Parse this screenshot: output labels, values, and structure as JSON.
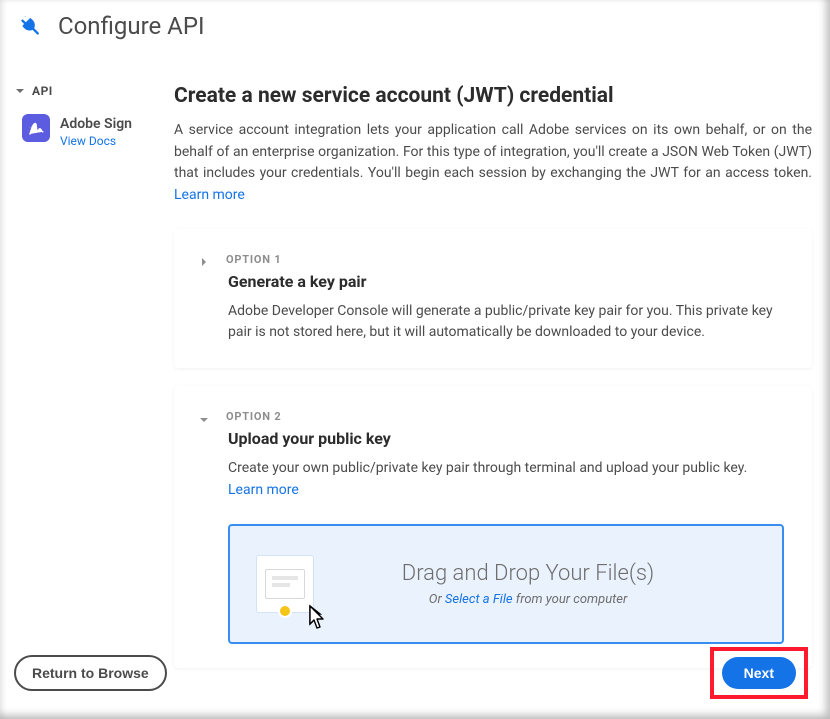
{
  "header": {
    "title": "Configure API"
  },
  "sidebar": {
    "section_label": "API",
    "item": {
      "title": "Adobe Sign",
      "docs_link": "View Docs"
    }
  },
  "main": {
    "heading": "Create a new service account (JWT) credential",
    "description_pre": "A service account integration lets your application call Adobe services on its own behalf, or on the behalf of an enterprise organization. For this type of integration, you'll create a JSON Web Token (JWT) that includes your credentials. You'll begin each session by exchanging the JWT for an access token. ",
    "description_link": "Learn more",
    "option1": {
      "label": "OPTION 1",
      "title": "Generate a key pair",
      "body": "Adobe Developer Console will generate a public/private key pair for you. This private key pair is not stored here, but it will automatically be downloaded to your device."
    },
    "option2": {
      "label": "OPTION 2",
      "title": "Upload your public key",
      "body_pre": "Create your own public/private key pair through terminal and upload your public key. ",
      "body_link": "Learn more",
      "dropzone": {
        "main_text": "Drag and Drop Your File(s)",
        "sub_pre": "Or ",
        "sub_link": "Select a File",
        "sub_post": " from your computer"
      }
    }
  },
  "footer": {
    "back_label": "Return to Browse",
    "next_label": "Next"
  }
}
